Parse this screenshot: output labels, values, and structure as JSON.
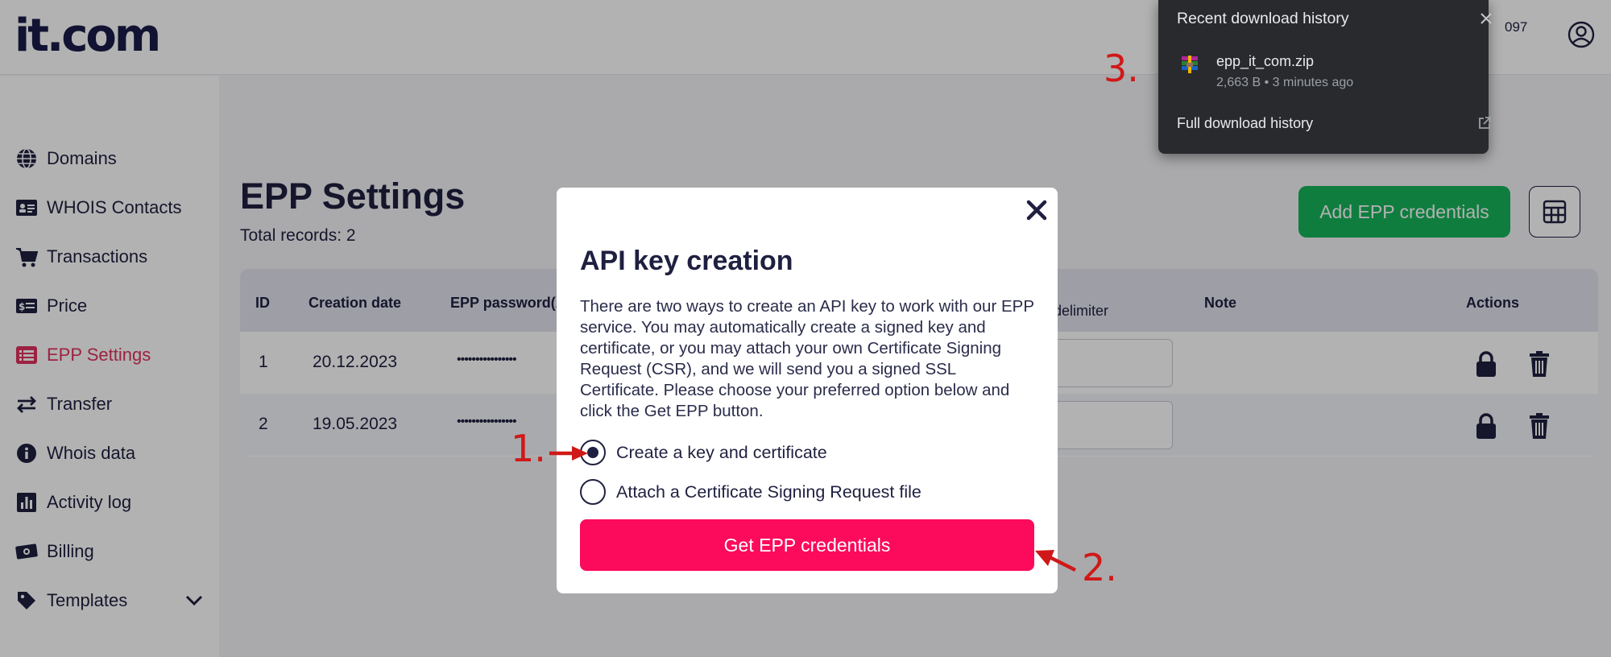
{
  "header": {
    "logo": "it.com",
    "account_number": "097"
  },
  "sidebar": {
    "items": [
      {
        "label": "Domains",
        "icon": "globe-icon"
      },
      {
        "label": "WHOIS Contacts",
        "icon": "contact-card-icon"
      },
      {
        "label": "Transactions",
        "icon": "cart-icon"
      },
      {
        "label": "Price",
        "icon": "price-tag-icon"
      },
      {
        "label": "EPP Settings",
        "icon": "list-icon",
        "active": true
      },
      {
        "label": "Transfer",
        "icon": "transfer-arrows-icon"
      },
      {
        "label": "Whois data",
        "icon": "info-icon"
      },
      {
        "label": "Activity log",
        "icon": "bar-chart-icon"
      },
      {
        "label": "Billing",
        "icon": "cash-icon"
      },
      {
        "label": "Templates",
        "icon": "tag-icon"
      }
    ]
  },
  "main": {
    "title": "EPP Settings",
    "total_records": "Total records: 2",
    "add_button": "Add EPP credentials",
    "table": {
      "headers": [
        "ID",
        "Creation date",
        "EPP password(A",
        "delimiter",
        "Note",
        "Actions"
      ],
      "rows": [
        {
          "id": "1",
          "date": "20.12.2023",
          "password": "••••••••••••••••"
        },
        {
          "id": "2",
          "date": "19.05.2023",
          "password": "••••••••••••••••"
        }
      ]
    }
  },
  "modal": {
    "title": "API key creation",
    "description": "There are two ways to create an API key to work with our EPP service. You may automatically create a signed key and certificate, or you may attach your own Certificate Signing Request (CSR), and we will send you a signed SSL Certificate. Please choose your preferred option below and click the Get EPP button.",
    "options": [
      {
        "label": "Create a key and certificate",
        "selected": true
      },
      {
        "label": "Attach a Certificate Signing Request file",
        "selected": false
      }
    ],
    "submit": "Get EPP credentials"
  },
  "annotations": {
    "step1": "1.",
    "step2": "2.",
    "step3": "3."
  },
  "downloads": {
    "title": "Recent download history",
    "file_name": "epp_it_com.zip",
    "file_meta": "2,663 B • 3 minutes ago",
    "full_history": "Full download history"
  },
  "colors": {
    "accent": "#fc0a5b",
    "active_nav": "#e0315e",
    "add_button": "#16b35a",
    "navy": "#1f2040",
    "annotation": "#d01818"
  }
}
